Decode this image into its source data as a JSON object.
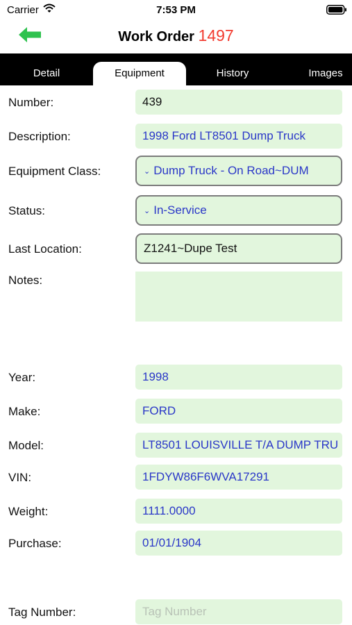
{
  "status": {
    "carrier": "Carrier",
    "time": "7:53 PM"
  },
  "nav": {
    "title_prefix": "Work Order",
    "order_number": "1497"
  },
  "tabs": [
    {
      "label": "Detail"
    },
    {
      "label": "Equipment"
    },
    {
      "label": "History"
    },
    {
      "label": "Images"
    }
  ],
  "form": {
    "number": {
      "label": "Number:",
      "value": "439"
    },
    "description": {
      "label": "Description:",
      "value": "1998 Ford LT8501 Dump Truck"
    },
    "equipment_class": {
      "label": "Equipment Class:",
      "value": "Dump Truck - On Road~DUM"
    },
    "status": {
      "label": "Status:",
      "value": "In-Service"
    },
    "last_location": {
      "label": "Last Location:",
      "value": "Z1241~Dupe Test"
    },
    "notes": {
      "label": "Notes:",
      "value": ""
    },
    "year": {
      "label": "Year:",
      "value": "1998"
    },
    "make": {
      "label": "Make:",
      "value": "FORD"
    },
    "model": {
      "label": "Model:",
      "value": "LT8501 LOUISVILLE T/A DUMP TRU"
    },
    "vin": {
      "label": "VIN:",
      "value": "1FDYW86F6WVA17291"
    },
    "weight": {
      "label": "Weight:",
      "value": "1111.0000"
    },
    "purchase": {
      "label": "Purchase:",
      "value": "01/01/1904"
    },
    "tag_number": {
      "label": "Tag Number:",
      "placeholder": "Tag Number"
    }
  },
  "colors": {
    "accent_red": "#f23b2f",
    "back_arrow": "#2fc24f",
    "field_bg": "#e2f6dd",
    "value_blue": "#2a37c8"
  },
  "icons": {
    "back": "back-arrow-icon",
    "wifi": "wifi-icon",
    "battery": "battery-icon",
    "dropdown": "chevron-down-icon"
  }
}
